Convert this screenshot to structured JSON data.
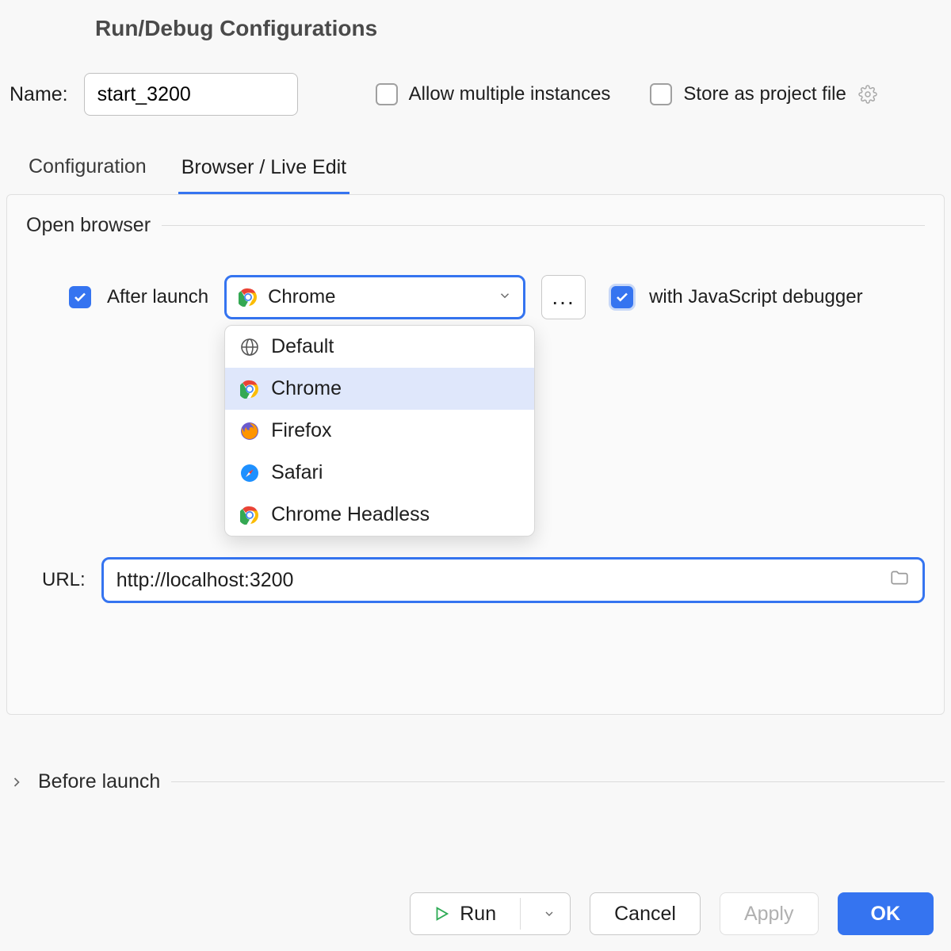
{
  "title": "Run/Debug Configurations",
  "name_label": "Name:",
  "name_value": "start_3200",
  "allow_multi": "Allow multiple instances",
  "store_project": "Store as project file",
  "tabs": {
    "config": "Configuration",
    "browser": "Browser / Live Edit"
  },
  "open_browser": "Open browser",
  "after_launch": "After launch",
  "browser_selected": "Chrome",
  "browser_options": [
    "Default",
    "Chrome",
    "Firefox",
    "Safari",
    "Chrome Headless"
  ],
  "with_debugger": "with JavaScript debugger",
  "url_label": "URL:",
  "url_value": "http://localhost:3200",
  "before_launch": "Before launch",
  "buttons": {
    "run": "Run",
    "cancel": "Cancel",
    "apply": "Apply",
    "ok": "OK"
  },
  "dots": "..."
}
